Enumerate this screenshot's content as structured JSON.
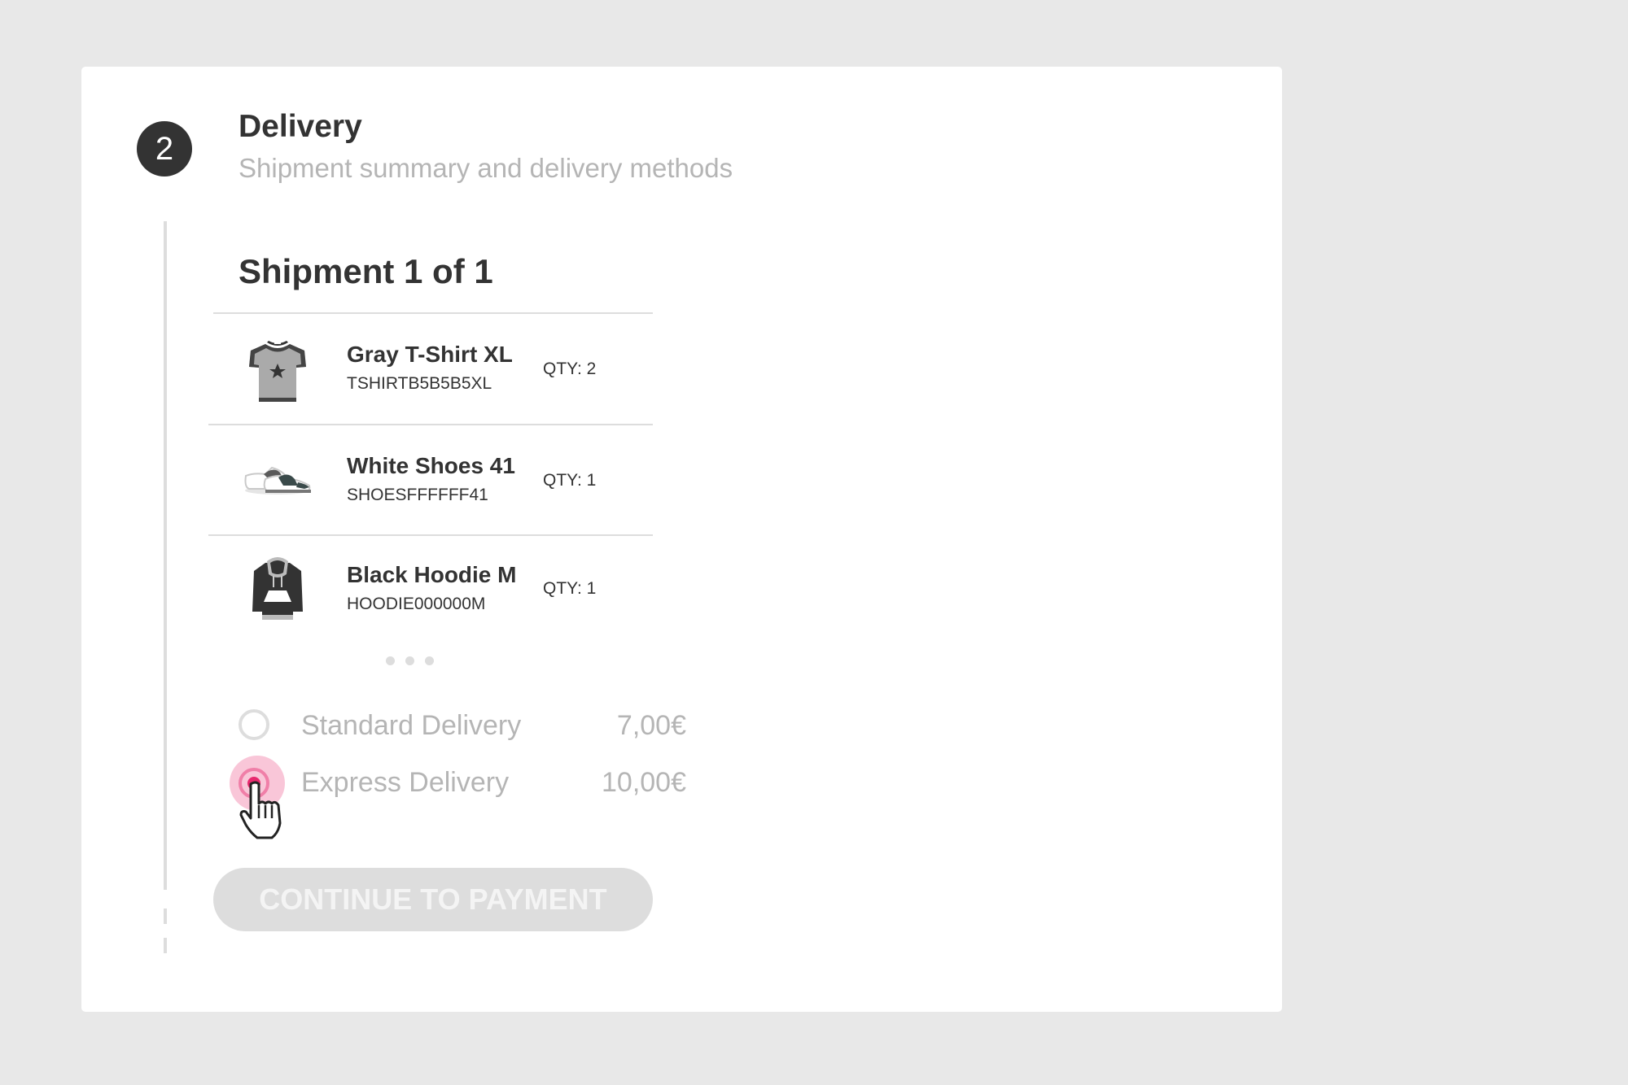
{
  "step": {
    "number": "2",
    "title": "Delivery",
    "subtitle": "Shipment summary and delivery methods"
  },
  "shipment": {
    "title": "Shipment 1 of 1",
    "items": [
      {
        "name": "Gray T-Shirt XL",
        "sku": "TSHIRTB5B5B5XL",
        "qty": "QTY: 2",
        "icon": "tshirt-icon"
      },
      {
        "name": "White Shoes 41",
        "sku": "SHOESFFFFFF41",
        "qty": "QTY: 1",
        "icon": "shoes-icon"
      },
      {
        "name": "Black Hoodie M",
        "sku": "HOODIE000000M",
        "qty": "QTY: 1",
        "icon": "hoodie-icon"
      }
    ],
    "more_icon": "more-dots-icon"
  },
  "delivery_options": [
    {
      "label": "Standard Delivery",
      "price": "7,00€",
      "selected": false
    },
    {
      "label": "Express Delivery",
      "price": "10,00€",
      "selected": true
    }
  ],
  "continue_label": "CONTINUE TO PAYMENT",
  "colors": {
    "background": "#e8e8e8",
    "card": "#ffffff",
    "text": "#333333",
    "muted": "#b5b5b5",
    "accent": "#e8296e",
    "disabled": "#dddddd"
  },
  "cursor_icon": "hand-pointer-icon"
}
